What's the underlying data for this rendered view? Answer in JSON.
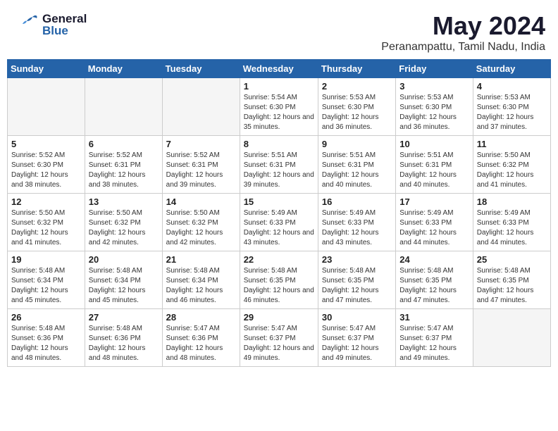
{
  "header": {
    "logo_general": "General",
    "logo_blue": "Blue",
    "title": "May 2024",
    "subtitle": "Peranampattu, Tamil Nadu, India"
  },
  "weekdays": [
    "Sunday",
    "Monday",
    "Tuesday",
    "Wednesday",
    "Thursday",
    "Friday",
    "Saturday"
  ],
  "weeks": [
    [
      {
        "day": "",
        "empty": true
      },
      {
        "day": "",
        "empty": true
      },
      {
        "day": "",
        "empty": true
      },
      {
        "day": "1",
        "sunrise": "5:54 AM",
        "sunset": "6:30 PM",
        "daylight": "12 hours and 35 minutes."
      },
      {
        "day": "2",
        "sunrise": "5:53 AM",
        "sunset": "6:30 PM",
        "daylight": "12 hours and 36 minutes."
      },
      {
        "day": "3",
        "sunrise": "5:53 AM",
        "sunset": "6:30 PM",
        "daylight": "12 hours and 36 minutes."
      },
      {
        "day": "4",
        "sunrise": "5:53 AM",
        "sunset": "6:30 PM",
        "daylight": "12 hours and 37 minutes."
      }
    ],
    [
      {
        "day": "5",
        "sunrise": "5:52 AM",
        "sunset": "6:30 PM",
        "daylight": "12 hours and 38 minutes."
      },
      {
        "day": "6",
        "sunrise": "5:52 AM",
        "sunset": "6:31 PM",
        "daylight": "12 hours and 38 minutes."
      },
      {
        "day": "7",
        "sunrise": "5:52 AM",
        "sunset": "6:31 PM",
        "daylight": "12 hours and 39 minutes."
      },
      {
        "day": "8",
        "sunrise": "5:51 AM",
        "sunset": "6:31 PM",
        "daylight": "12 hours and 39 minutes."
      },
      {
        "day": "9",
        "sunrise": "5:51 AM",
        "sunset": "6:31 PM",
        "daylight": "12 hours and 40 minutes."
      },
      {
        "day": "10",
        "sunrise": "5:51 AM",
        "sunset": "6:31 PM",
        "daylight": "12 hours and 40 minutes."
      },
      {
        "day": "11",
        "sunrise": "5:50 AM",
        "sunset": "6:32 PM",
        "daylight": "12 hours and 41 minutes."
      }
    ],
    [
      {
        "day": "12",
        "sunrise": "5:50 AM",
        "sunset": "6:32 PM",
        "daylight": "12 hours and 41 minutes."
      },
      {
        "day": "13",
        "sunrise": "5:50 AM",
        "sunset": "6:32 PM",
        "daylight": "12 hours and 42 minutes."
      },
      {
        "day": "14",
        "sunrise": "5:50 AM",
        "sunset": "6:32 PM",
        "daylight": "12 hours and 42 minutes."
      },
      {
        "day": "15",
        "sunrise": "5:49 AM",
        "sunset": "6:33 PM",
        "daylight": "12 hours and 43 minutes."
      },
      {
        "day": "16",
        "sunrise": "5:49 AM",
        "sunset": "6:33 PM",
        "daylight": "12 hours and 43 minutes."
      },
      {
        "day": "17",
        "sunrise": "5:49 AM",
        "sunset": "6:33 PM",
        "daylight": "12 hours and 44 minutes."
      },
      {
        "day": "18",
        "sunrise": "5:49 AM",
        "sunset": "6:33 PM",
        "daylight": "12 hours and 44 minutes."
      }
    ],
    [
      {
        "day": "19",
        "sunrise": "5:48 AM",
        "sunset": "6:34 PM",
        "daylight": "12 hours and 45 minutes."
      },
      {
        "day": "20",
        "sunrise": "5:48 AM",
        "sunset": "6:34 PM",
        "daylight": "12 hours and 45 minutes."
      },
      {
        "day": "21",
        "sunrise": "5:48 AM",
        "sunset": "6:34 PM",
        "daylight": "12 hours and 46 minutes."
      },
      {
        "day": "22",
        "sunrise": "5:48 AM",
        "sunset": "6:35 PM",
        "daylight": "12 hours and 46 minutes."
      },
      {
        "day": "23",
        "sunrise": "5:48 AM",
        "sunset": "6:35 PM",
        "daylight": "12 hours and 47 minutes."
      },
      {
        "day": "24",
        "sunrise": "5:48 AM",
        "sunset": "6:35 PM",
        "daylight": "12 hours and 47 minutes."
      },
      {
        "day": "25",
        "sunrise": "5:48 AM",
        "sunset": "6:35 PM",
        "daylight": "12 hours and 47 minutes."
      }
    ],
    [
      {
        "day": "26",
        "sunrise": "5:48 AM",
        "sunset": "6:36 PM",
        "daylight": "12 hours and 48 minutes."
      },
      {
        "day": "27",
        "sunrise": "5:48 AM",
        "sunset": "6:36 PM",
        "daylight": "12 hours and 48 minutes."
      },
      {
        "day": "28",
        "sunrise": "5:47 AM",
        "sunset": "6:36 PM",
        "daylight": "12 hours and 48 minutes."
      },
      {
        "day": "29",
        "sunrise": "5:47 AM",
        "sunset": "6:37 PM",
        "daylight": "12 hours and 49 minutes."
      },
      {
        "day": "30",
        "sunrise": "5:47 AM",
        "sunset": "6:37 PM",
        "daylight": "12 hours and 49 minutes."
      },
      {
        "day": "31",
        "sunrise": "5:47 AM",
        "sunset": "6:37 PM",
        "daylight": "12 hours and 49 minutes."
      },
      {
        "day": "",
        "empty": true
      }
    ]
  ]
}
